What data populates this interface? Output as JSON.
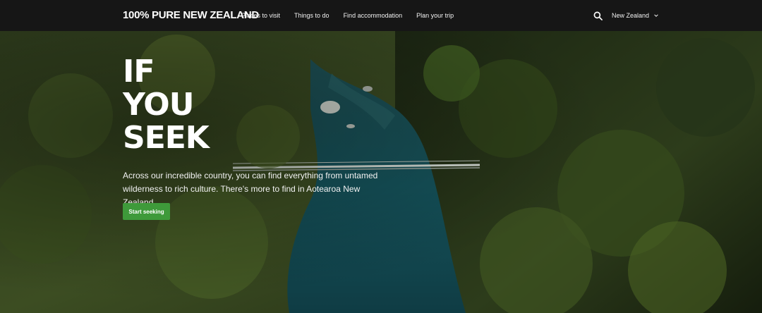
{
  "header": {
    "logo_text": "100% PURE NEW ZEALAND",
    "nav": [
      "Places to visit",
      "Things to do",
      "Find accommodation",
      "Plan your trip"
    ],
    "region_label": "New Zealand",
    "icons": {
      "search": "search-icon",
      "region": "chevron-down-icon"
    }
  },
  "hero": {
    "headline": [
      "IF",
      "YOU",
      "SEEK"
    ],
    "description": "Across our incredible country, you can find everything from untamed wilderness to rich culture. There's more to find in Aotearoa New Zealand.",
    "cta_label": "Start seeking",
    "colors": {
      "cta": "#3e9a3a",
      "nav_bg": "#161616"
    }
  }
}
